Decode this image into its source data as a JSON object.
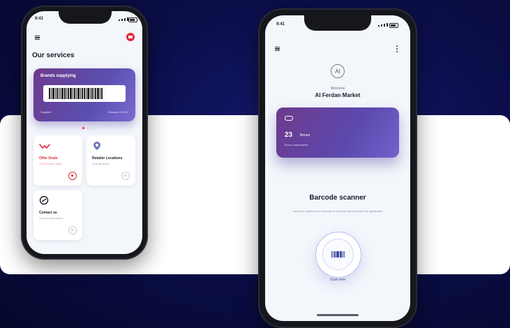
{
  "colors": {
    "background": "#0b0e4a",
    "band": "#ffffff",
    "accent_red": "#e2293f",
    "card_purple": "#5a4fb0",
    "scan_blue": "#3b4a9e"
  },
  "left_phone": {
    "status_time": "9:41",
    "services_title": "Our services",
    "promo": {
      "title": "Brands supplying",
      "footer_left": "Supplied",
      "footer_right": "Scanned 2 of 12"
    },
    "tiles": [
      {
        "name": "Offer Deals",
        "sub": "15 Exclusive offers",
        "icon": "handshake-icon"
      },
      {
        "name": "Retailer Locations",
        "sub": "Find all stores",
        "icon": "map-pin-icon"
      },
      {
        "name": "Contact us",
        "sub": "Contact information",
        "icon": "headset-icon"
      }
    ]
  },
  "right_phone": {
    "status_time": "9:41",
    "logo_text": "AI",
    "welcome": "Welcome",
    "market_name": "Al Ferdan Market",
    "points": {
      "value": "23",
      "unit": "Bonus",
      "sub": "Bonus redeemable"
    },
    "barcode": {
      "title": "Barcode scanner",
      "description": "Scan the customers ID barcode to scan the barcode from the application",
      "button_label": "Scan now"
    }
  }
}
